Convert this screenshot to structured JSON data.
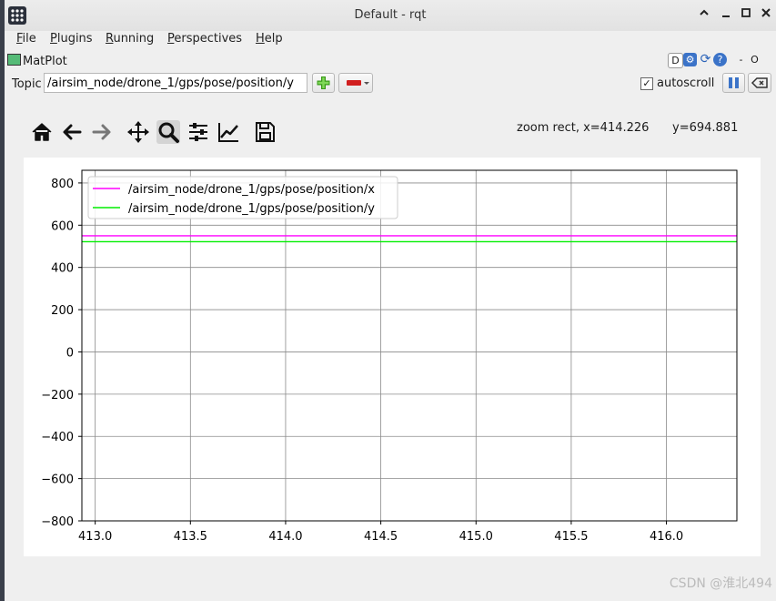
{
  "window": {
    "title": "Default - rqt"
  },
  "menu": [
    {
      "label": "File",
      "underline": "F",
      "rest": "ile"
    },
    {
      "label": "Plugins",
      "underline": "P",
      "rest": "lugins"
    },
    {
      "label": "Running",
      "underline": "R",
      "rest": "unning"
    },
    {
      "label": "Perspectives",
      "underline": "P",
      "rest": "erspectives"
    },
    {
      "label": "Help",
      "underline": "H",
      "rest": "elp"
    }
  ],
  "plugin": {
    "title": "MatPlot",
    "dock_buttons": {
      "d_label": "D",
      "minimize": "-",
      "close": "O"
    },
    "topic_label": "Topic",
    "topic_value": "/airsim_node/drone_1/gps/pose/position/y",
    "autoscroll_label": "autoscroll",
    "autoscroll_checked": "✓"
  },
  "toolbar": {
    "icons": [
      "home-icon",
      "back-arrow-icon",
      "forward-arrow-icon",
      "pan-icon",
      "zoom-icon",
      "configure-subplots-icon",
      "edit-axes-icon",
      "save-icon"
    ],
    "status_x": "zoom rect, x=414.226",
    "status_y": "y=694.881"
  },
  "chart_data": {
    "type": "line",
    "title": "",
    "xlabel": "",
    "ylabel": "",
    "xlim": [
      412.93,
      416.37
    ],
    "ylim": [
      -800,
      860
    ],
    "x_ticks": [
      413.0,
      413.5,
      414.0,
      414.5,
      415.0,
      415.5,
      416.0
    ],
    "x_tick_labels": [
      "413.0",
      "413.5",
      "414.0",
      "414.5",
      "415.0",
      "415.5",
      "416.0"
    ],
    "y_ticks": [
      800,
      600,
      400,
      200,
      0,
      -200,
      -400,
      -600,
      -800
    ],
    "y_tick_labels": [
      "800",
      "600",
      "400",
      "200",
      "0",
      "−200",
      "−400",
      "−600",
      "−800"
    ],
    "grid": true,
    "legend_position": "top-left",
    "series": [
      {
        "name": "/airsim_node/drone_1/gps/pose/position/x",
        "color": "#ff00ff",
        "x": [
          412.93,
          416.37
        ],
        "values": [
          550,
          550
        ]
      },
      {
        "name": "/airsim_node/drone_1/gps/pose/position/y",
        "color": "#00ee00",
        "x": [
          412.93,
          416.37
        ],
        "values": [
          522,
          522
        ]
      }
    ]
  },
  "watermark": "CSDN @淮北494"
}
